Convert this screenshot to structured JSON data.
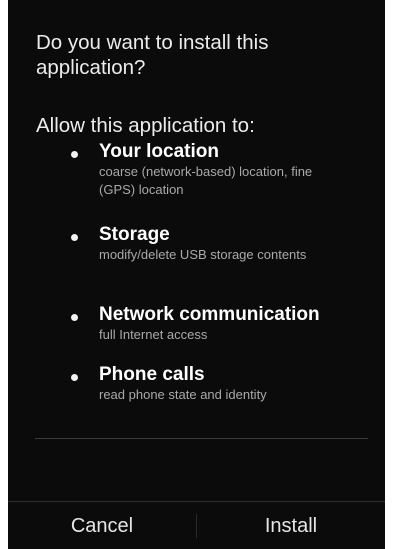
{
  "dialog": {
    "question": "Do you want to install this application?",
    "allow_heading": "Allow this application to:",
    "permissions": [
      {
        "name": "Your location",
        "description": "coarse (network-based) location, fine (GPS) location"
      },
      {
        "name": "Storage",
        "description": "modify/delete USB storage contents"
      },
      {
        "name": "Network communication",
        "description": "full Internet access"
      },
      {
        "name": "Phone calls",
        "description": "read phone state and identity"
      }
    ],
    "truncated_more_text": "\" \""
  },
  "buttons": {
    "cancel_label": "Cancel",
    "install_label": "Install"
  },
  "colors": {
    "background": "#0b0b0b",
    "text_primary": "#ffffff",
    "text_secondary": "#a9a9a9",
    "divider": "#3a3a3a"
  },
  "icons": {
    "bullet": "bullet-icon"
  }
}
